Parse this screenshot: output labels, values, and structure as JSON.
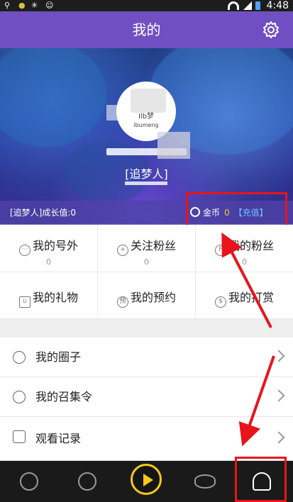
{
  "status_bar": {
    "time": "4:48"
  },
  "header": {
    "title": "我的",
    "settings_icon": "gear-icon"
  },
  "profile": {
    "avatar_logo_text": "Ilb梦",
    "avatar_logo_sub": "ibumeng",
    "rank_title": "[追梦人]"
  },
  "growth_bar": {
    "growth_label": "[追梦人]成长值:0",
    "coin_label": "金币",
    "coin_value": "0",
    "recharge_label": "【充值】"
  },
  "grid": [
    {
      "label": "我的号外",
      "count": "0",
      "icon": "haowai-icon"
    },
    {
      "label": "关注粉丝",
      "count": "0",
      "icon": "follow-user-icon"
    },
    {
      "label": "我的粉丝",
      "count": "0",
      "icon": "fans-icon"
    },
    {
      "label": "我的礼物",
      "count": "",
      "icon": "gift-icon"
    },
    {
      "label": "我的预约",
      "count": "",
      "icon": "reservation-icon"
    },
    {
      "label": "我的打赏",
      "count": "",
      "icon": "reward-icon"
    }
  ],
  "list": [
    {
      "label": "我的圈子",
      "icon": "circle-star-icon"
    },
    {
      "label": "我的召集令",
      "icon": "location-pin-icon"
    },
    {
      "label": "观看记录",
      "icon": "history-edit-icon"
    }
  ],
  "bottom_nav": [
    {
      "name": "play",
      "icon": "play-circle-icon"
    },
    {
      "name": "star",
      "icon": "star-circle-icon"
    },
    {
      "name": "home",
      "icon": "live-center-icon"
    },
    {
      "name": "watch",
      "icon": "eye-icon"
    },
    {
      "name": "me",
      "icon": "user-icon"
    }
  ],
  "colors": {
    "header": "#6f4fc1",
    "accent_coin": "#f5c23a",
    "recharge": "#6ec0ff",
    "annotation": "#e8141c",
    "nav_center": "#f5c91a"
  }
}
